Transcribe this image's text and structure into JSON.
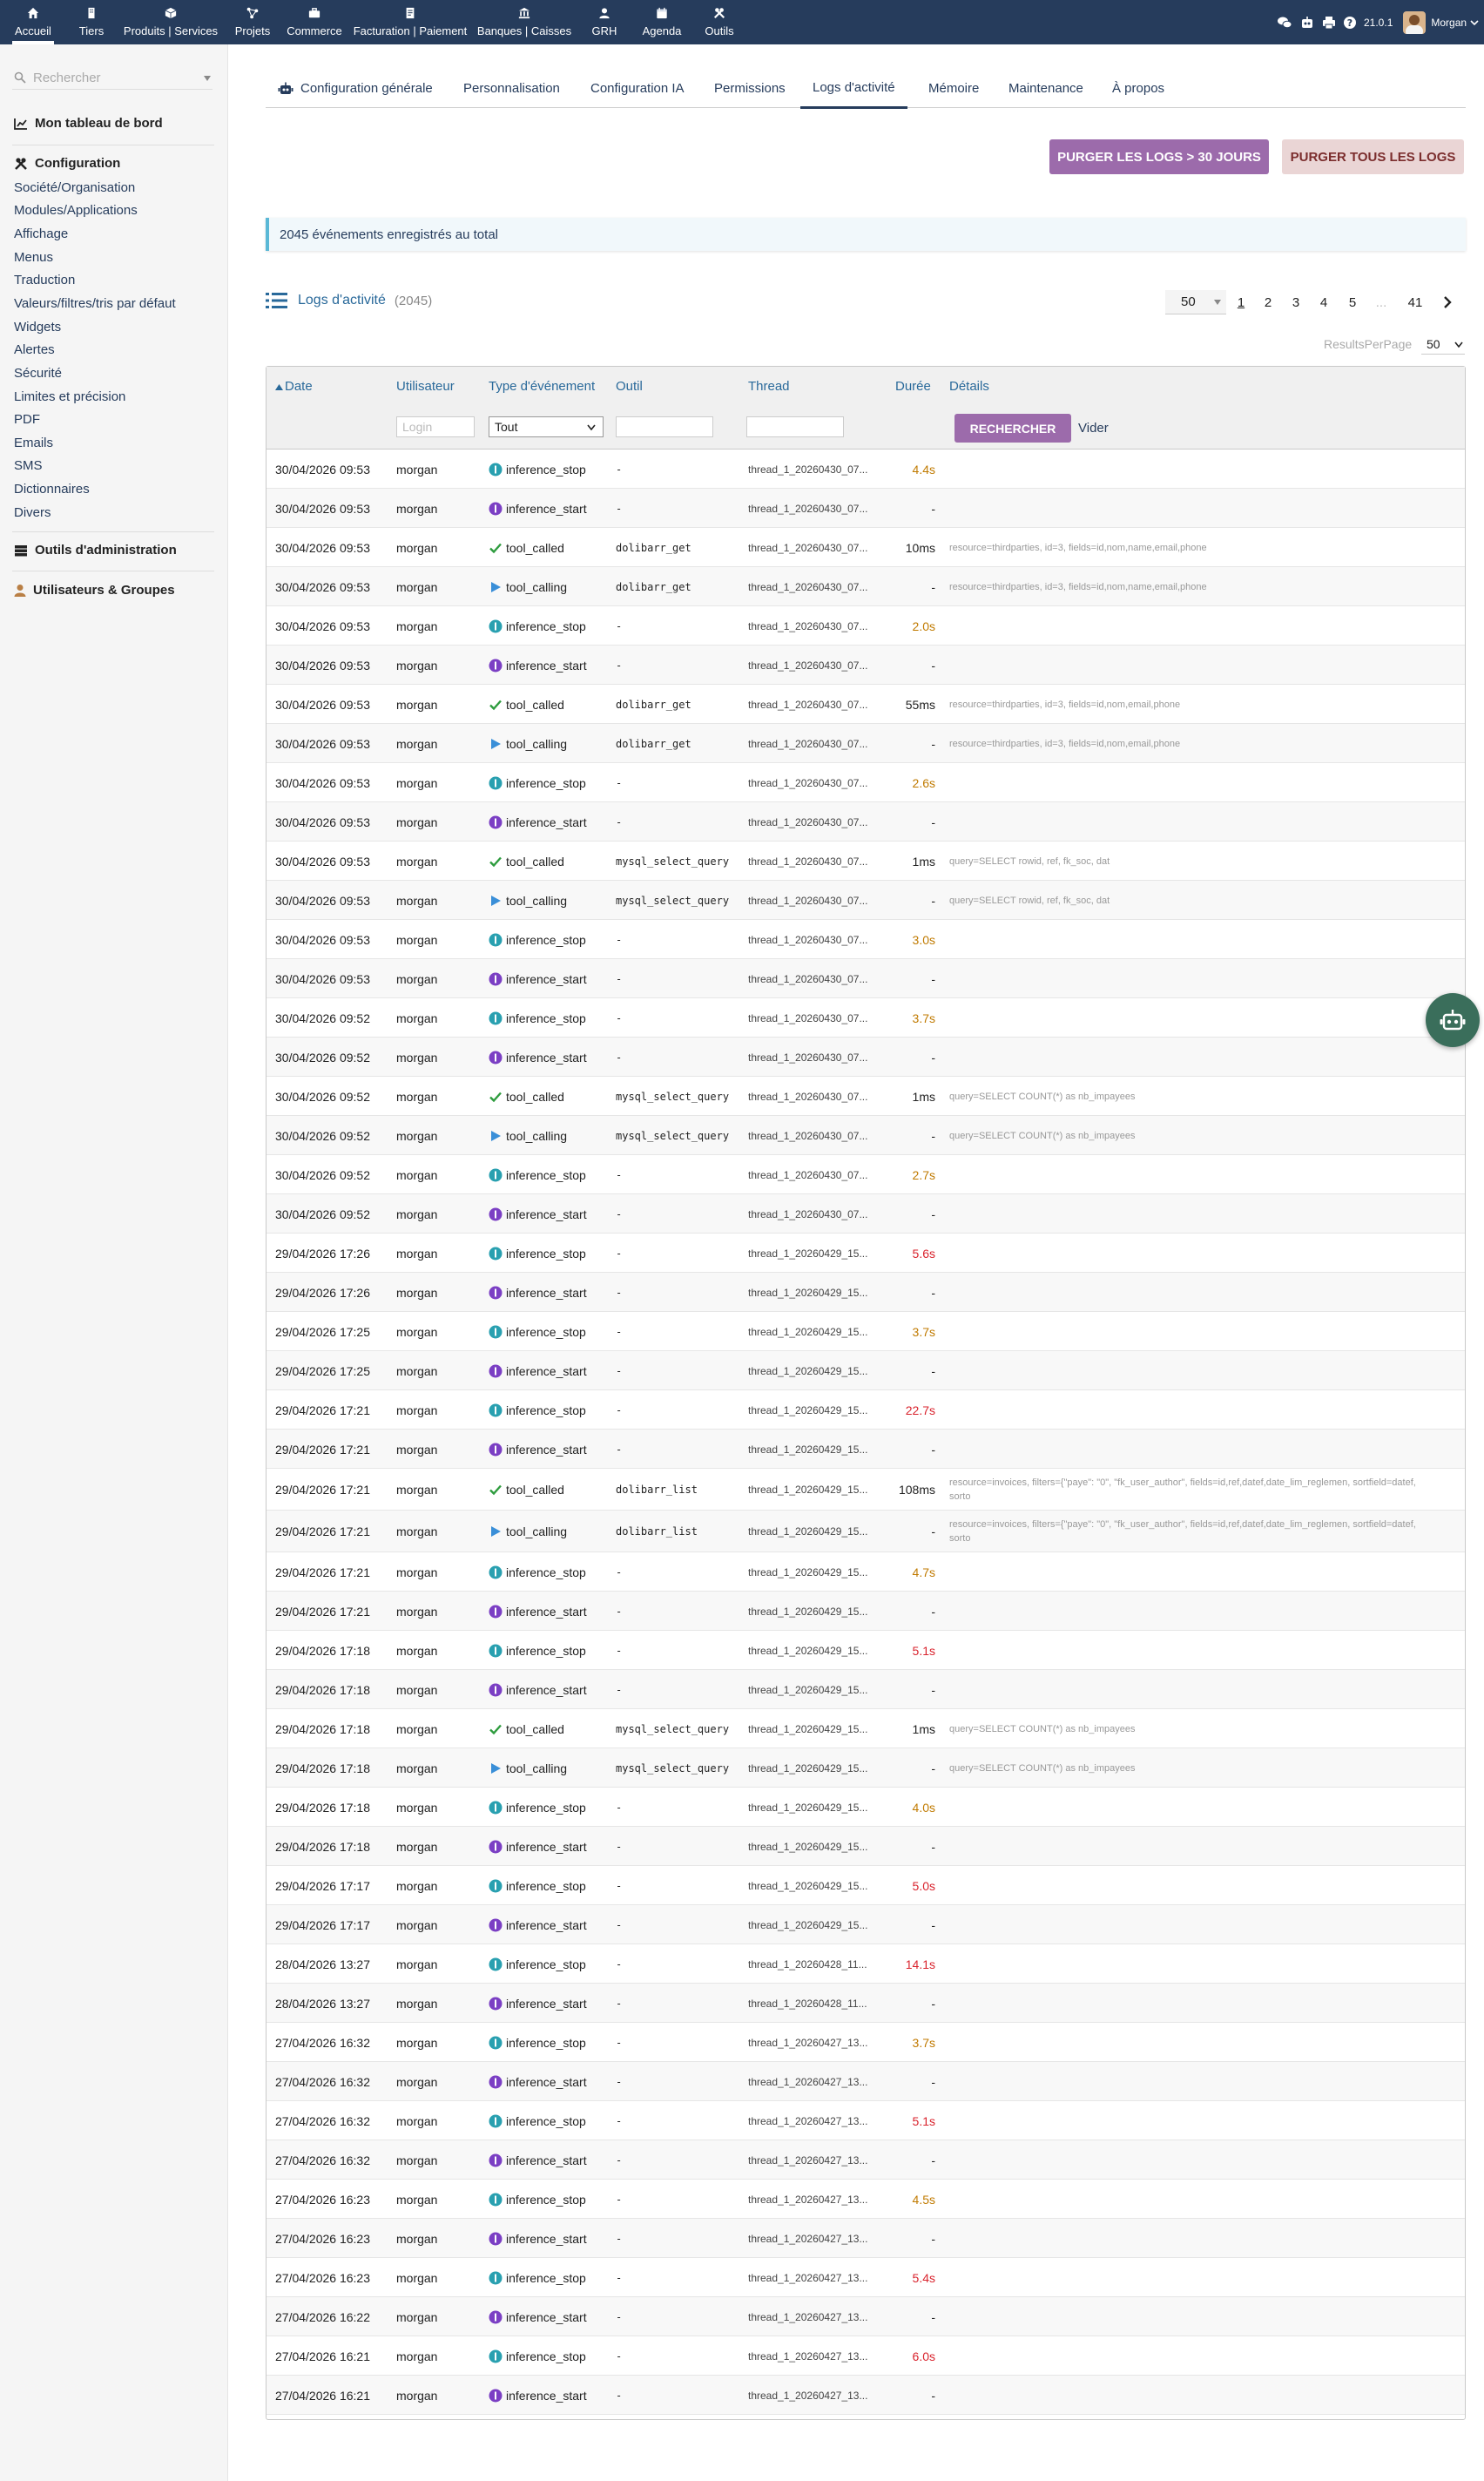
{
  "topbar": {
    "menus": [
      {
        "label": "Accueil",
        "icon": "home-icon"
      },
      {
        "label": "Tiers",
        "icon": "building-icon"
      },
      {
        "label": "Produits | Services",
        "icon": "cube-icon"
      },
      {
        "label": "Projets",
        "icon": "project-icon"
      },
      {
        "label": "Commerce",
        "icon": "briefcase-icon"
      },
      {
        "label": "Facturation | Paiement",
        "icon": "invoice-icon"
      },
      {
        "label": "Banques | Caisses",
        "icon": "bank-icon"
      },
      {
        "label": "GRH",
        "icon": "user-icon"
      },
      {
        "label": "Agenda",
        "icon": "calendar-icon"
      },
      {
        "label": "Outils",
        "icon": "tools-icon"
      }
    ],
    "version": "21.0.1",
    "user": "Morgan"
  },
  "sidebar": {
    "search_placeholder": "Rechercher",
    "dashboard": "Mon tableau de bord",
    "configuration": "Configuration",
    "config_items": [
      "Société/Organisation",
      "Modules/Applications",
      "Affichage",
      "Menus",
      "Traduction",
      "Valeurs/filtres/tris par défaut",
      "Widgets",
      "Alertes",
      "Sécurité",
      "Limites et précision",
      "PDF",
      "Emails",
      "SMS",
      "Dictionnaires",
      "Divers"
    ],
    "admin_tools": "Outils d'administration",
    "users_groups": "Utilisateurs & Groupes"
  },
  "tabs": [
    "Configuration générale",
    "Personnalisation",
    "Configuration IA",
    "Permissions",
    "Logs d'activité",
    "Mémoire",
    "Maintenance",
    "À propos"
  ],
  "actions": {
    "purge_30": "PURGER LES LOGS > 30 JOURS",
    "purge_all": "PURGER TOUS LES LOGS"
  },
  "info": "2045 événements enregistrés au total",
  "list": {
    "title": "Logs d'activité",
    "count": "(2045)",
    "per_page_value": "50",
    "pages": [
      "1",
      "2",
      "3",
      "4",
      "5",
      "...",
      "41"
    ],
    "results_per_page_label": "ResultsPerPage",
    "results_per_page_value": "50"
  },
  "table": {
    "columns": [
      "Date",
      "Utilisateur",
      "Type d'événement",
      "Outil",
      "Thread",
      "Durée",
      "Détails"
    ],
    "filters": {
      "login_placeholder": "Login",
      "type_value": "Tout",
      "search_button": "RECHERCHER",
      "clear_link": "Vider"
    },
    "rows": [
      {
        "date": "30/04/2026 09:53",
        "user": "morgan",
        "type": "inference_stop",
        "tool": "-",
        "thread": "thread_1_20260430_07...",
        "duration": "4.4s",
        "details": ""
      },
      {
        "date": "30/04/2026 09:53",
        "user": "morgan",
        "type": "inference_start",
        "tool": "-",
        "thread": "thread_1_20260430_07...",
        "duration": "-",
        "details": ""
      },
      {
        "date": "30/04/2026 09:53",
        "user": "morgan",
        "type": "tool_called",
        "tool": "dolibarr_get",
        "thread": "thread_1_20260430_07...",
        "duration": "10ms",
        "details": "resource=thirdparties, id=3, fields=id,nom,name,email,phone"
      },
      {
        "date": "30/04/2026 09:53",
        "user": "morgan",
        "type": "tool_calling",
        "tool": "dolibarr_get",
        "thread": "thread_1_20260430_07...",
        "duration": "-",
        "details": "resource=thirdparties, id=3, fields=id,nom,name,email,phone"
      },
      {
        "date": "30/04/2026 09:53",
        "user": "morgan",
        "type": "inference_stop",
        "tool": "-",
        "thread": "thread_1_20260430_07...",
        "duration": "2.0s",
        "details": ""
      },
      {
        "date": "30/04/2026 09:53",
        "user": "morgan",
        "type": "inference_start",
        "tool": "-",
        "thread": "thread_1_20260430_07...",
        "duration": "-",
        "details": ""
      },
      {
        "date": "30/04/2026 09:53",
        "user": "morgan",
        "type": "tool_called",
        "tool": "dolibarr_get",
        "thread": "thread_1_20260430_07...",
        "duration": "55ms",
        "details": "resource=thirdparties, id=3, fields=id,nom,email,phone"
      },
      {
        "date": "30/04/2026 09:53",
        "user": "morgan",
        "type": "tool_calling",
        "tool": "dolibarr_get",
        "thread": "thread_1_20260430_07...",
        "duration": "-",
        "details": "resource=thirdparties, id=3, fields=id,nom,email,phone"
      },
      {
        "date": "30/04/2026 09:53",
        "user": "morgan",
        "type": "inference_stop",
        "tool": "-",
        "thread": "thread_1_20260430_07...",
        "duration": "2.6s",
        "details": ""
      },
      {
        "date": "30/04/2026 09:53",
        "user": "morgan",
        "type": "inference_start",
        "tool": "-",
        "thread": "thread_1_20260430_07...",
        "duration": "-",
        "details": ""
      },
      {
        "date": "30/04/2026 09:53",
        "user": "morgan",
        "type": "tool_called",
        "tool": "mysql_select_query",
        "thread": "thread_1_20260430_07...",
        "duration": "1ms",
        "details": "query=SELECT rowid, ref, fk_soc, dat"
      },
      {
        "date": "30/04/2026 09:53",
        "user": "morgan",
        "type": "tool_calling",
        "tool": "mysql_select_query",
        "thread": "thread_1_20260430_07...",
        "duration": "-",
        "details": "query=SELECT rowid, ref, fk_soc, dat"
      },
      {
        "date": "30/04/2026 09:53",
        "user": "morgan",
        "type": "inference_stop",
        "tool": "-",
        "thread": "thread_1_20260430_07...",
        "duration": "3.0s",
        "details": ""
      },
      {
        "date": "30/04/2026 09:53",
        "user": "morgan",
        "type": "inference_start",
        "tool": "-",
        "thread": "thread_1_20260430_07...",
        "duration": "-",
        "details": ""
      },
      {
        "date": "30/04/2026 09:52",
        "user": "morgan",
        "type": "inference_stop",
        "tool": "-",
        "thread": "thread_1_20260430_07...",
        "duration": "3.7s",
        "details": ""
      },
      {
        "date": "30/04/2026 09:52",
        "user": "morgan",
        "type": "inference_start",
        "tool": "-",
        "thread": "thread_1_20260430_07...",
        "duration": "-",
        "details": ""
      },
      {
        "date": "30/04/2026 09:52",
        "user": "morgan",
        "type": "tool_called",
        "tool": "mysql_select_query",
        "thread": "thread_1_20260430_07...",
        "duration": "1ms",
        "details": "query=SELECT COUNT(*) as nb_impayees"
      },
      {
        "date": "30/04/2026 09:52",
        "user": "morgan",
        "type": "tool_calling",
        "tool": "mysql_select_query",
        "thread": "thread_1_20260430_07...",
        "duration": "-",
        "details": "query=SELECT COUNT(*) as nb_impayees"
      },
      {
        "date": "30/04/2026 09:52",
        "user": "morgan",
        "type": "inference_stop",
        "tool": "-",
        "thread": "thread_1_20260430_07...",
        "duration": "2.7s",
        "details": ""
      },
      {
        "date": "30/04/2026 09:52",
        "user": "morgan",
        "type": "inference_start",
        "tool": "-",
        "thread": "thread_1_20260430_07...",
        "duration": "-",
        "details": ""
      },
      {
        "date": "29/04/2026 17:26",
        "user": "morgan",
        "type": "inference_stop",
        "tool": "-",
        "thread": "thread_1_20260429_15...",
        "duration": "5.6s",
        "details": ""
      },
      {
        "date": "29/04/2026 17:26",
        "user": "morgan",
        "type": "inference_start",
        "tool": "-",
        "thread": "thread_1_20260429_15...",
        "duration": "-",
        "details": ""
      },
      {
        "date": "29/04/2026 17:25",
        "user": "morgan",
        "type": "inference_stop",
        "tool": "-",
        "thread": "thread_1_20260429_15...",
        "duration": "3.7s",
        "details": ""
      },
      {
        "date": "29/04/2026 17:25",
        "user": "morgan",
        "type": "inference_start",
        "tool": "-",
        "thread": "thread_1_20260429_15...",
        "duration": "-",
        "details": ""
      },
      {
        "date": "29/04/2026 17:21",
        "user": "morgan",
        "type": "inference_stop",
        "tool": "-",
        "thread": "thread_1_20260429_15...",
        "duration": "22.7s",
        "details": ""
      },
      {
        "date": "29/04/2026 17:21",
        "user": "morgan",
        "type": "inference_start",
        "tool": "-",
        "thread": "thread_1_20260429_15...",
        "duration": "-",
        "details": ""
      },
      {
        "date": "29/04/2026 17:21",
        "user": "morgan",
        "type": "tool_called",
        "tool": "dolibarr_list",
        "thread": "thread_1_20260429_15...",
        "duration": "108ms",
        "details": "resource=invoices, filters={\"paye\": \"0\", \"fk_user_author\", fields=id,ref,datef,date_lim_reglemen, sortfield=datef, sorto"
      },
      {
        "date": "29/04/2026 17:21",
        "user": "morgan",
        "type": "tool_calling",
        "tool": "dolibarr_list",
        "thread": "thread_1_20260429_15...",
        "duration": "-",
        "details": "resource=invoices, filters={\"paye\": \"0\", \"fk_user_author\", fields=id,ref,datef,date_lim_reglemen, sortfield=datef, sorto"
      },
      {
        "date": "29/04/2026 17:21",
        "user": "morgan",
        "type": "inference_stop",
        "tool": "-",
        "thread": "thread_1_20260429_15...",
        "duration": "4.7s",
        "details": ""
      },
      {
        "date": "29/04/2026 17:21",
        "user": "morgan",
        "type": "inference_start",
        "tool": "-",
        "thread": "thread_1_20260429_15...",
        "duration": "-",
        "details": ""
      },
      {
        "date": "29/04/2026 17:18",
        "user": "morgan",
        "type": "inference_stop",
        "tool": "-",
        "thread": "thread_1_20260429_15...",
        "duration": "5.1s",
        "details": ""
      },
      {
        "date": "29/04/2026 17:18",
        "user": "morgan",
        "type": "inference_start",
        "tool": "-",
        "thread": "thread_1_20260429_15...",
        "duration": "-",
        "details": ""
      },
      {
        "date": "29/04/2026 17:18",
        "user": "morgan",
        "type": "tool_called",
        "tool": "mysql_select_query",
        "thread": "thread_1_20260429_15...",
        "duration": "1ms",
        "details": "query=SELECT COUNT(*) as nb_impayees"
      },
      {
        "date": "29/04/2026 17:18",
        "user": "morgan",
        "type": "tool_calling",
        "tool": "mysql_select_query",
        "thread": "thread_1_20260429_15...",
        "duration": "-",
        "details": "query=SELECT COUNT(*) as nb_impayees"
      },
      {
        "date": "29/04/2026 17:18",
        "user": "morgan",
        "type": "inference_stop",
        "tool": "-",
        "thread": "thread_1_20260429_15...",
        "duration": "4.0s",
        "details": ""
      },
      {
        "date": "29/04/2026 17:18",
        "user": "morgan",
        "type": "inference_start",
        "tool": "-",
        "thread": "thread_1_20260429_15...",
        "duration": "-",
        "details": ""
      },
      {
        "date": "29/04/2026 17:17",
        "user": "morgan",
        "type": "inference_stop",
        "tool": "-",
        "thread": "thread_1_20260429_15...",
        "duration": "5.0s",
        "details": ""
      },
      {
        "date": "29/04/2026 17:17",
        "user": "morgan",
        "type": "inference_start",
        "tool": "-",
        "thread": "thread_1_20260429_15...",
        "duration": "-",
        "details": ""
      },
      {
        "date": "28/04/2026 13:27",
        "user": "morgan",
        "type": "inference_stop",
        "tool": "-",
        "thread": "thread_1_20260428_11...",
        "duration": "14.1s",
        "details": ""
      },
      {
        "date": "28/04/2026 13:27",
        "user": "morgan",
        "type": "inference_start",
        "tool": "-",
        "thread": "thread_1_20260428_11...",
        "duration": "-",
        "details": ""
      },
      {
        "date": "27/04/2026 16:32",
        "user": "morgan",
        "type": "inference_stop",
        "tool": "-",
        "thread": "thread_1_20260427_13...",
        "duration": "3.7s",
        "details": ""
      },
      {
        "date": "27/04/2026 16:32",
        "user": "morgan",
        "type": "inference_start",
        "tool": "-",
        "thread": "thread_1_20260427_13...",
        "duration": "-",
        "details": ""
      },
      {
        "date": "27/04/2026 16:32",
        "user": "morgan",
        "type": "inference_stop",
        "tool": "-",
        "thread": "thread_1_20260427_13...",
        "duration": "5.1s",
        "details": ""
      },
      {
        "date": "27/04/2026 16:32",
        "user": "morgan",
        "type": "inference_start",
        "tool": "-",
        "thread": "thread_1_20260427_13...",
        "duration": "-",
        "details": ""
      },
      {
        "date": "27/04/2026 16:23",
        "user": "morgan",
        "type": "inference_stop",
        "tool": "-",
        "thread": "thread_1_20260427_13...",
        "duration": "4.5s",
        "details": ""
      },
      {
        "date": "27/04/2026 16:23",
        "user": "morgan",
        "type": "inference_start",
        "tool": "-",
        "thread": "thread_1_20260427_13...",
        "duration": "-",
        "details": ""
      },
      {
        "date": "27/04/2026 16:23",
        "user": "morgan",
        "type": "inference_stop",
        "tool": "-",
        "thread": "thread_1_20260427_13...",
        "duration": "5.4s",
        "details": ""
      },
      {
        "date": "27/04/2026 16:22",
        "user": "morgan",
        "type": "inference_start",
        "tool": "-",
        "thread": "thread_1_20260427_13...",
        "duration": "-",
        "details": ""
      },
      {
        "date": "27/04/2026 16:21",
        "user": "morgan",
        "type": "inference_stop",
        "tool": "-",
        "thread": "thread_1_20260427_13...",
        "duration": "6.0s",
        "details": ""
      },
      {
        "date": "27/04/2026 16:21",
        "user": "morgan",
        "type": "inference_start",
        "tool": "-",
        "thread": "thread_1_20260427_13...",
        "duration": "-",
        "details": ""
      }
    ]
  },
  "colors": {
    "topbar": "#263c5c",
    "accent_purple": "#9c6bab",
    "link_blue": "#29699a",
    "duration_orange": "#c07a00",
    "duration_red": "#d9232d",
    "inference_stop": "#29a0b0",
    "inference_start": "#7b3fc4",
    "tool_called": "#2e9c3e",
    "tool_calling": "#3a8fd8"
  }
}
